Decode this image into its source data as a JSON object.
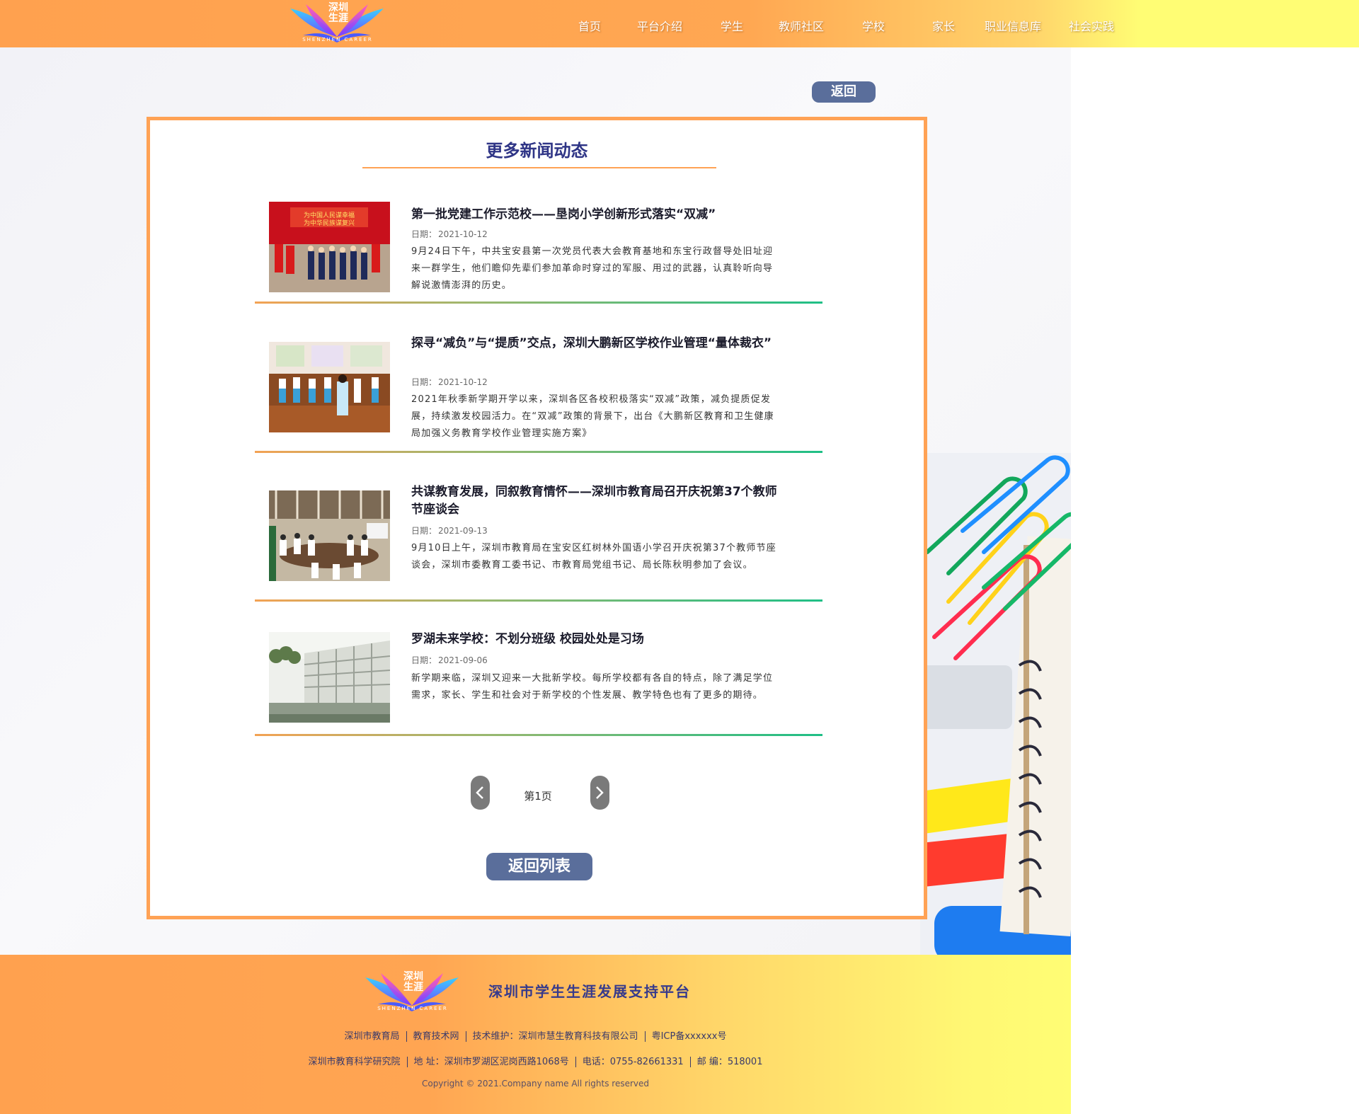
{
  "header": {
    "logo": {
      "text_cn": "深圳生涯",
      "text_en": "SHENZHEN CAREER"
    },
    "nav": [
      "首页",
      "平台介绍",
      "学生",
      "教师社区",
      "学校",
      "家长",
      "职业信息库",
      "社会实践"
    ]
  },
  "back_button": "返回",
  "panel": {
    "title": "更多新闻动态",
    "date_label": "日期：",
    "news": [
      {
        "title": "第一批党建工作示范校——垦岗小学创新形式落实“双减”",
        "date": "2021-10-12",
        "summary": "9月24日下午，中共宝安县第一次党员代表大会教育基地和东宝行政督导处旧址迎来一群学生，他们瞻仰先辈们参加革命时穿过的军服、用过的武器，认真聆听向导解说激情澎湃的历史。",
        "image": "party-building-event-photo"
      },
      {
        "title": "探寻“减负”与“提质”交点，深圳大鹏新区学校作业管理“量体裁衣”",
        "date": "2021-10-12",
        "summary": "2021年秋季新学期开学以来，深圳各区各校积极落实“双减”政策，减负提质促发展，持续激发校园活力。在“双减”政策的背景下，出台《大鹏新区教育和卫生健康局加强义务教育学校作业管理实施方案》",
        "image": "students-classroom-photo"
      },
      {
        "title": "共谋教育发展，同叙教育情怀——深圳市教育局召开庆祝第37个教师节座谈会",
        "date": "2021-09-13",
        "summary": "9月10日上午，深圳市教育局在宝安区红树林外国语小学召开庆祝第37个教师节座谈会，深圳市委教育工委书记、市教育局党组书记、局长陈秋明参加了会议。",
        "image": "meeting-room-photo"
      },
      {
        "title": "罗湖未来学校：不划分班级 校园处处是习场",
        "date": "2021-09-06",
        "summary": "新学期来临，深圳又迎来一大批新学校。每所学校都有各自的特点，除了满足学位需求，家长、学生和社会对于新学校的个性发展、教学特色也有了更多的期待。",
        "image": "school-building-photo"
      }
    ],
    "pager": {
      "prev_icon": "chevron-left-icon",
      "next_icon": "chevron-right-icon",
      "page_text": "第1页"
    },
    "return_list": "返回列表"
  },
  "footer": {
    "logo": {
      "text_cn": "深圳生涯",
      "text_en": "SHENZHEN CAREER"
    },
    "platform_name": "深圳市学生生涯发展支持平台",
    "line1": [
      "深圳市教育局",
      "教育技术网",
      "技术维护：深圳市慧生教育科技有限公司",
      "粤ICP备xxxxxx号"
    ],
    "line2": [
      "深圳市教育科学研究院",
      "地  址：深圳市罗湖区泥岗西路1068号",
      "电话：0755-82661331",
      "邮  编：518001"
    ],
    "copyright": "Copyright © 2021.Company name All rights reserved"
  },
  "colors": {
    "header_orange": "#ffa14f",
    "header_yellow": "#fffd74",
    "panel_border": "#ffa255",
    "title_navy": "#2f3586",
    "button_blue": "#5a6e9b",
    "separator_green": "#1fbf86"
  }
}
